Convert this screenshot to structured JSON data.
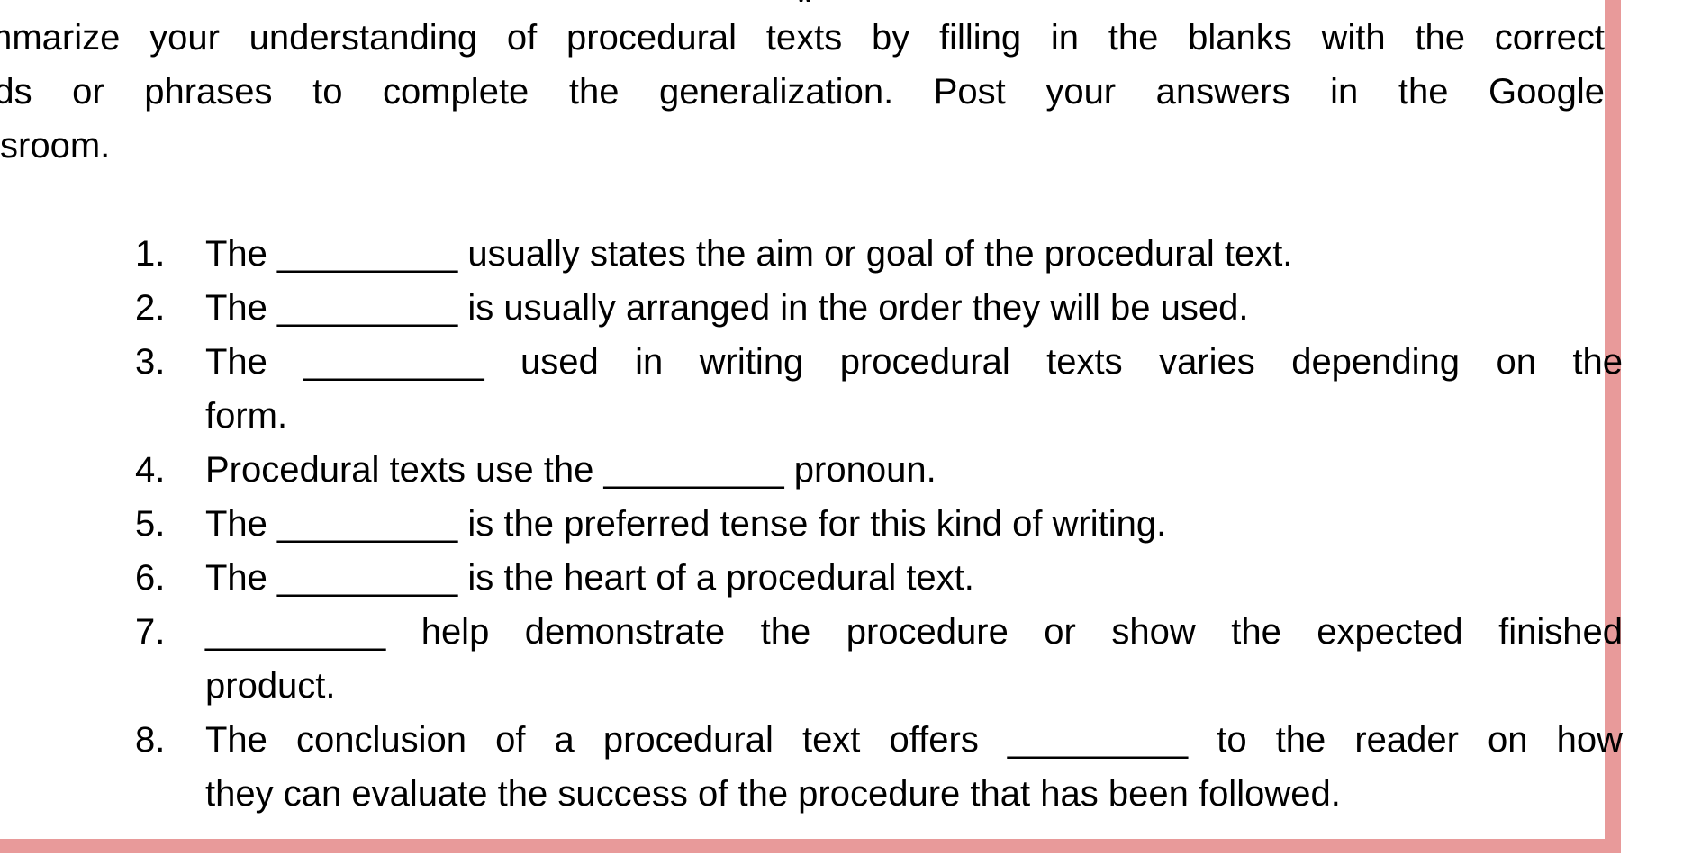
{
  "top_glyph": "w",
  "intro": {
    "lines": [
      "mmarize your understanding of procedural texts by filling in the blanks with the correct",
      "rds or phrases to complete the generalization. Post your answers in the Google",
      "ssroom."
    ]
  },
  "items": [
    {
      "num": "1.",
      "line1": "The _________ usually states the aim or goal of the procedural text.",
      "line2": ""
    },
    {
      "num": "2.",
      "line1": "The _________ is usually arranged in the order they will be used.",
      "line2": ""
    },
    {
      "num": "3.",
      "line1": "The _________ used in writing procedural texts varies depending on the",
      "line2": "form."
    },
    {
      "num": "4.",
      "line1": "Procedural texts use the _________ pronoun.",
      "line2": ""
    },
    {
      "num": "5.",
      "line1": "The _________ is the preferred tense for this kind of writing.",
      "line2": ""
    },
    {
      "num": "6.",
      "line1": "The _________ is the heart of a procedural text.",
      "line2": ""
    },
    {
      "num": "7.",
      "line1": "_________ help demonstrate the procedure or show the expected finished",
      "line2": "product."
    },
    {
      "num": "8.",
      "line1": "The conclusion of a procedural text offers _________ to the reader on how",
      "line2": "they can evaluate the success of the procedure that has been followed."
    }
  ],
  "colors": {
    "border": "#e89a9a"
  }
}
